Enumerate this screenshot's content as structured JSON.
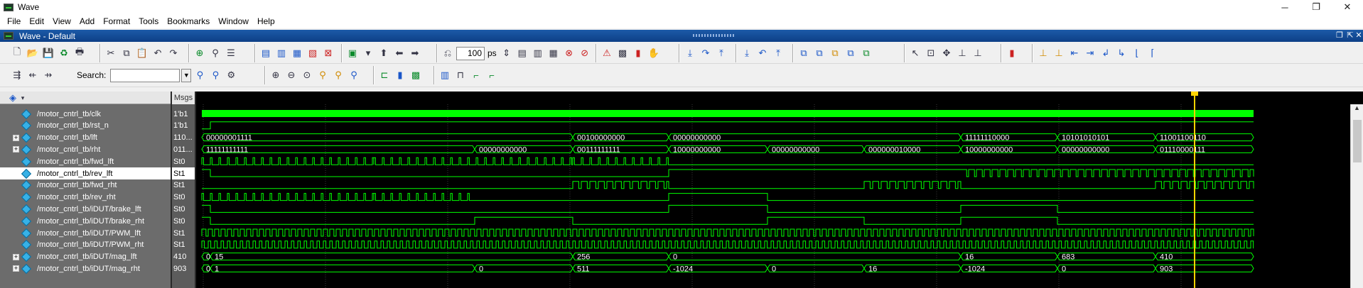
{
  "window": {
    "title": "Wave"
  },
  "window_controls": {
    "minimize": "─",
    "maximize": "❐",
    "close": "✕"
  },
  "menu": [
    "File",
    "Edit",
    "View",
    "Add",
    "Format",
    "Tools",
    "Bookmarks",
    "Window",
    "Help"
  ],
  "wave_window": {
    "title": "Wave - Default"
  },
  "toolbar": {
    "time_step_value": "100",
    "time_step_unit": "ps",
    "search_label": "Search:",
    "search_value": ""
  },
  "panes": {
    "msgs_header": "Msgs"
  },
  "signals": [
    {
      "name": "/motor_cntrl_tb/clk",
      "value": "1'b1",
      "expandable": false
    },
    {
      "name": "/motor_cntrl_tb/rst_n",
      "value": "1'b1",
      "expandable": false
    },
    {
      "name": "/motor_cntrl_tb/lft",
      "value": "110...",
      "expandable": true
    },
    {
      "name": "/motor_cntrl_tb/rht",
      "value": "011...",
      "expandable": true
    },
    {
      "name": "/motor_cntrl_tb/fwd_lft",
      "value": "St0",
      "expandable": false
    },
    {
      "name": "/motor_cntrl_tb/rev_lft",
      "value": "St1",
      "expandable": false,
      "selected": true
    },
    {
      "name": "/motor_cntrl_tb/fwd_rht",
      "value": "St1",
      "expandable": false
    },
    {
      "name": "/motor_cntrl_tb/rev_rht",
      "value": "St0",
      "expandable": false
    },
    {
      "name": "/motor_cntrl_tb/iDUT/brake_lft",
      "value": "St0",
      "expandable": false
    },
    {
      "name": "/motor_cntrl_tb/iDUT/brake_rht",
      "value": "St0",
      "expandable": false
    },
    {
      "name": "/motor_cntrl_tb/iDUT/PWM_lft",
      "value": "St1",
      "expandable": false
    },
    {
      "name": "/motor_cntrl_tb/iDUT/PWM_rht",
      "value": "St1",
      "expandable": false
    },
    {
      "name": "/motor_cntrl_tb/iDUT/mag_lft",
      "value": "410",
      "expandable": true
    },
    {
      "name": "/motor_cntrl_tb/iDUT/mag_rht",
      "value": "903",
      "expandable": true
    }
  ],
  "bus_values": {
    "lft": [
      "00000001111",
      "00100000000",
      "00000000000",
      "11111110000",
      "10101010101",
      "11001100110"
    ],
    "rht": [
      "11111111111",
      "00000000000",
      "00111111111",
      "10000000000",
      "00000000000",
      "000000010000",
      "10000000000",
      "00000000000",
      "01110000111"
    ],
    "mag_lft": [
      "0",
      "15",
      "256",
      "0",
      "16",
      "683",
      "410"
    ],
    "mag_rht": [
      "0",
      "1",
      "0",
      "511",
      "-1024",
      "0",
      "16",
      "-1024",
      "0",
      "903"
    ]
  },
  "colors": {
    "wave": "#00ff00",
    "cursor": "#ffd400",
    "grid": "#3a3a3a",
    "diamond": "#37b1e6"
  }
}
